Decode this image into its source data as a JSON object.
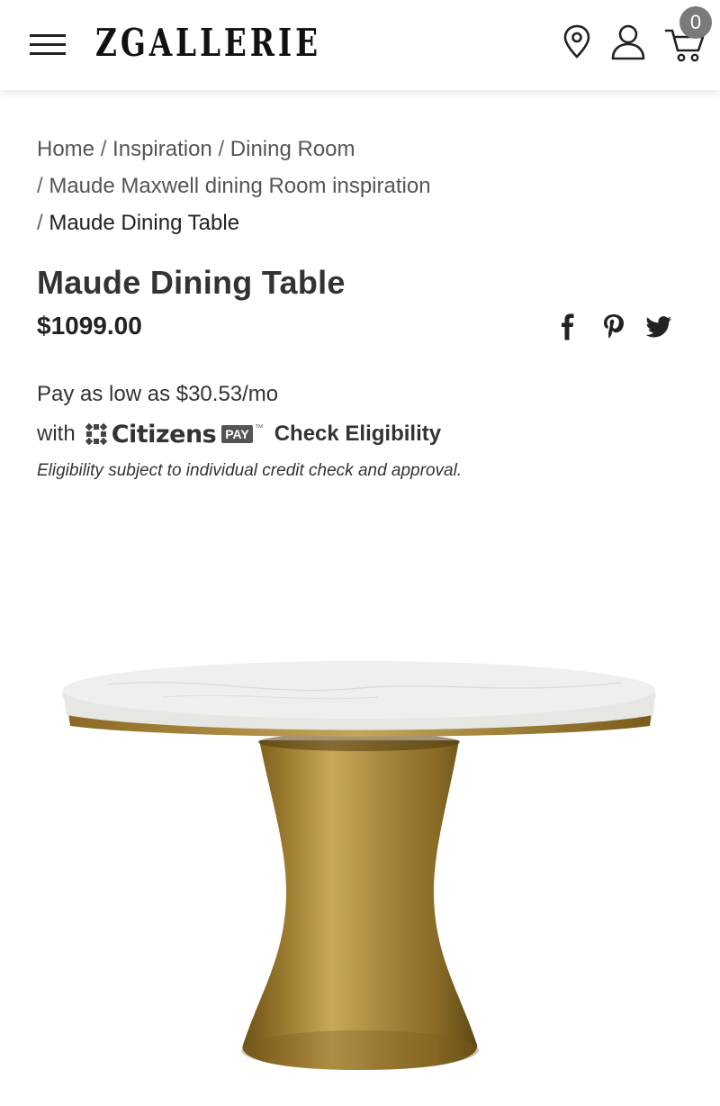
{
  "header": {
    "logo_text": "ZGALLERIE",
    "cart_count": "0",
    "icons": [
      "menu-icon",
      "location-pin-icon",
      "user-icon",
      "cart-icon"
    ]
  },
  "breadcrumb": {
    "items": [
      "Home",
      "Inspiration",
      "Dining Room",
      "Maude Maxwell dining Room inspiration",
      "Maude Dining Table"
    ],
    "separator": "/"
  },
  "product": {
    "title": "Maude Dining Table",
    "price": "$1099.00",
    "share_icons": [
      "facebook-icon",
      "pinterest-icon",
      "twitter-icon"
    ]
  },
  "financing": {
    "pay_as_low": "Pay as low as $30.53/mo",
    "with": "with",
    "brand_name": "Citizens",
    "brand_tag": "PAY",
    "check_label": "Check Eligibility",
    "disclaimer": "Eligibility subject to individual credit check and approval."
  },
  "colors": {
    "gold": "#a88a3e",
    "marble": "#ececea",
    "text": "#333333"
  }
}
